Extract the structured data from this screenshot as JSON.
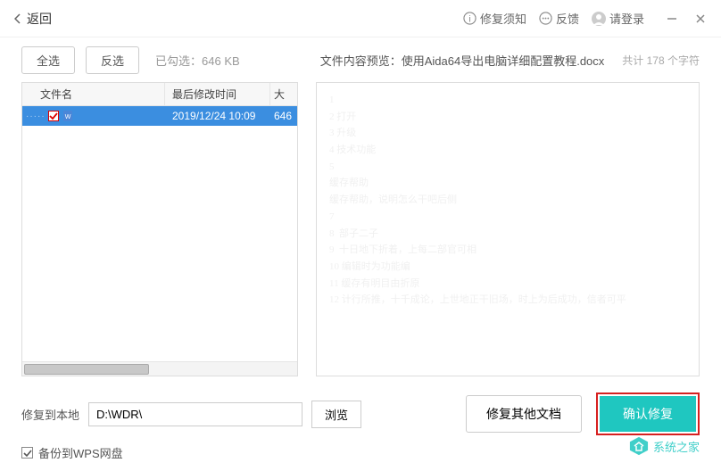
{
  "titlebar": {
    "back": "返回",
    "repair_notice": "修复须知",
    "feedback": "反馈",
    "login": "请登录"
  },
  "toolbar": {
    "select_all": "全选",
    "invert_select": "反选",
    "selected_info": "已勾选：646 KB",
    "preview_title": "文件内容预览：使用Aida64导出电脑详细配置教程.docx",
    "char_count": "共计 178 个字符"
  },
  "table": {
    "header": {
      "name": "文件名",
      "modified": "最后修改时间",
      "size": "大"
    },
    "rows": [
      {
        "name": "",
        "date": "2019/12/24 10:09",
        "size": "646"
      }
    ]
  },
  "preview": {
    "text": "1\n2 打开\n3 升级\n4 技术功能\n5\n缓存帮助\n缓存帮助，说明怎么干吧后侧\n7\n8  部子二子\n9  十日地下折着，上每二部官可相\n10 编辑时为功能编\n11 缓存有明目由折原\n12 计行所推，十千成论，上世地正干旧场，时上为后成功，信者可平"
  },
  "footer": {
    "path_label": "修复到本地",
    "path_value": "D:\\WDR\\",
    "browse": "浏览",
    "other_docs": "修复其他文档",
    "confirm": "确认修复",
    "backup_label": "备份到WPS网盘",
    "watermark": "系统之家"
  }
}
